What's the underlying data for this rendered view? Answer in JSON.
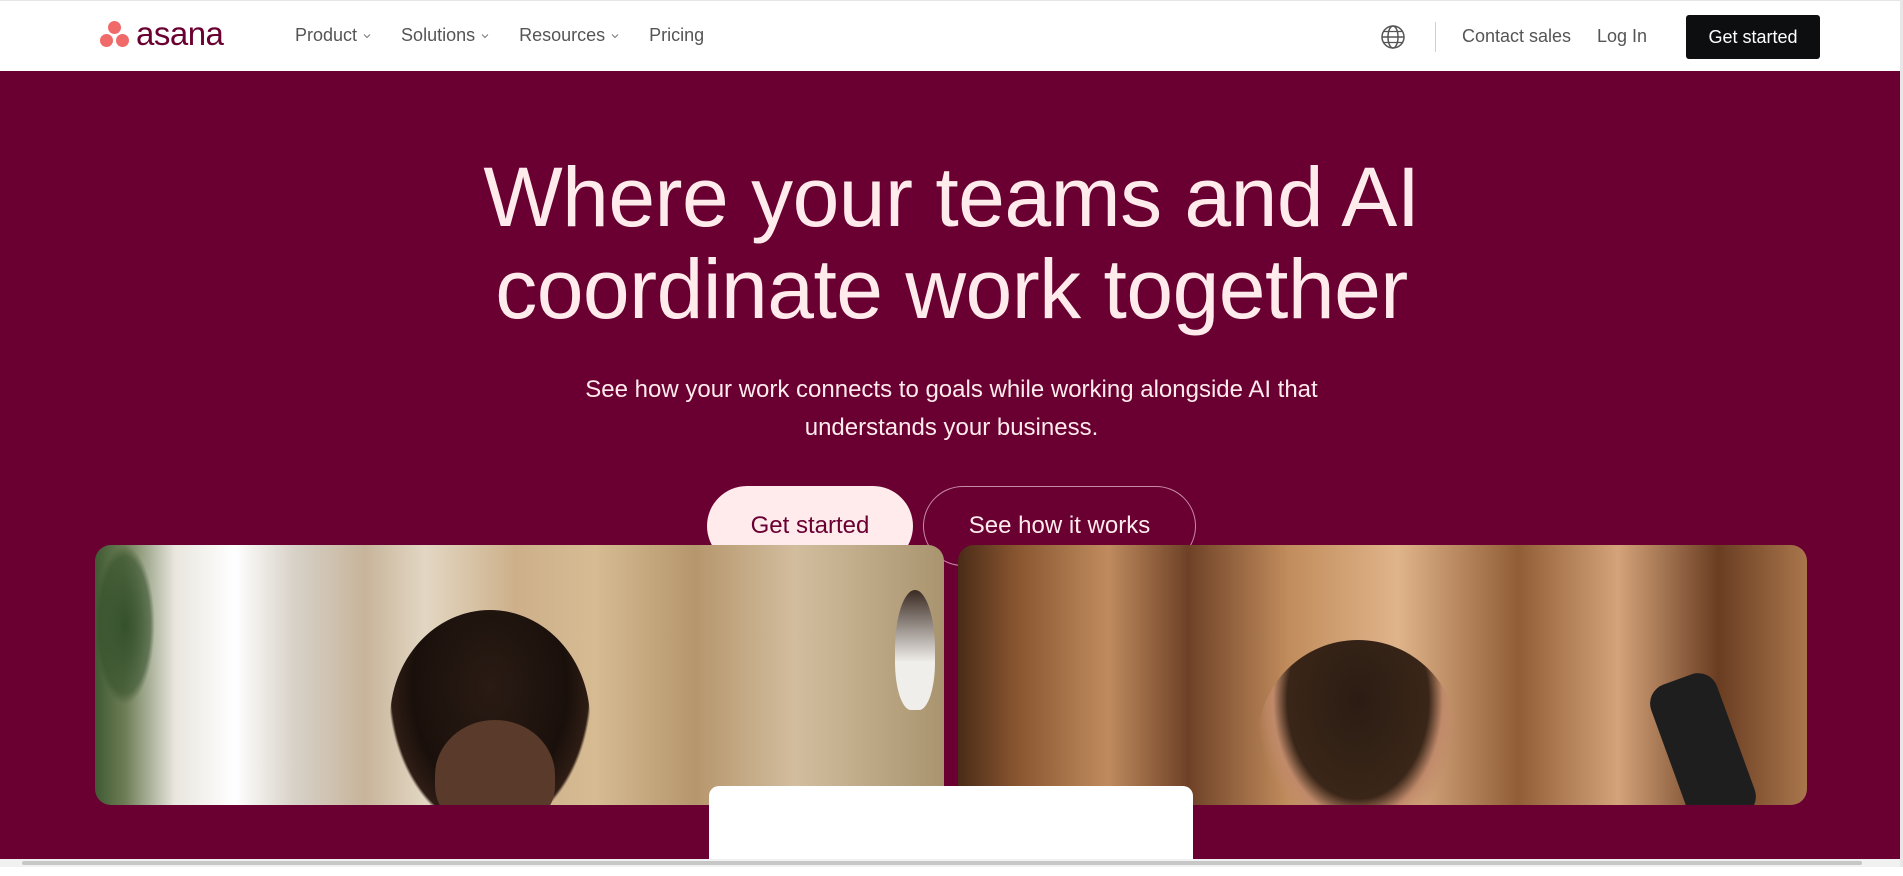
{
  "brand": {
    "name": "asana",
    "dot_color": "#f06a6a",
    "text_color": "#690031"
  },
  "nav": {
    "items": [
      {
        "label": "Product",
        "has_dropdown": true
      },
      {
        "label": "Solutions",
        "has_dropdown": true
      },
      {
        "label": "Resources",
        "has_dropdown": true
      },
      {
        "label": "Pricing",
        "has_dropdown": false
      }
    ],
    "language_icon": "globe-icon",
    "contact_sales": "Contact sales",
    "log_in": "Log In",
    "get_started": "Get started"
  },
  "hero": {
    "headline_line1": "Where your teams and AI",
    "headline_line2": "coordinate work together",
    "subheadline_line1": "See how your work connects to goals while working alongside AI that",
    "subheadline_line2": "understands your business.",
    "primary_cta": "Get started",
    "secondary_cta": "See how it works",
    "background_color": "#690031",
    "text_color": "#ffeaec"
  }
}
